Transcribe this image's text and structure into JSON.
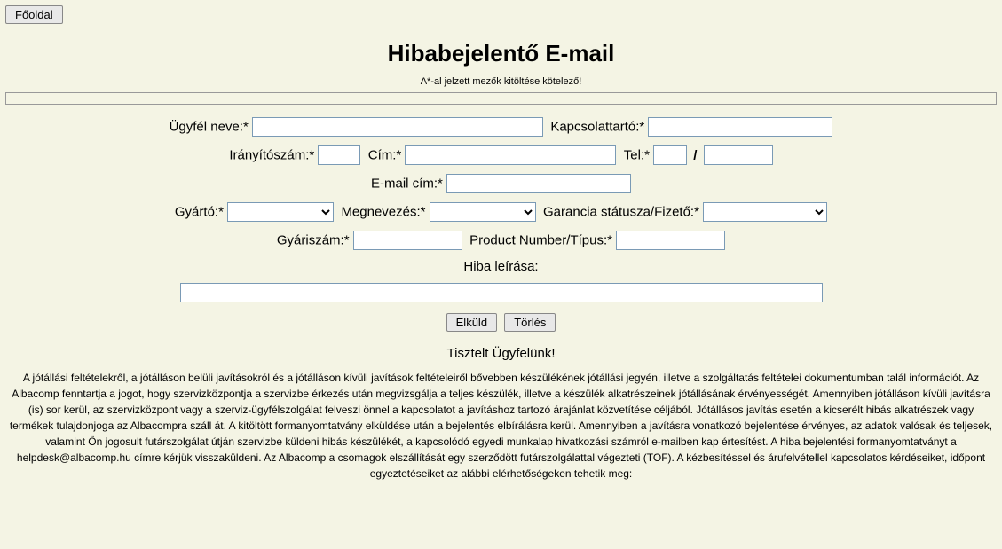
{
  "header": {
    "home_button": "Főoldal",
    "title": "Hibabejelentő E-mail",
    "subtitle": "A*-al jelzett mezők kitöltése kötelező!"
  },
  "form": {
    "customer_name_label": "Ügyfél neve:*",
    "contact_label": "Kapcsolattartó:*",
    "postal_code_label": "Irányítószám:*",
    "address_label": "Cím:*",
    "tel_label": "Tel:*",
    "email_label": "E-mail cím:*",
    "manufacturer_label": "Gyártó:*",
    "product_name_label": "Megnevezés:*",
    "warranty_status_label": "Garancia státusza/Fizető:*",
    "serial_number_label": "Gyáriszám:*",
    "product_number_label": "Product Number/Típus:*",
    "issue_desc_label": "Hiba leírása:",
    "submit_label": "Elküld",
    "reset_label": "Törlés"
  },
  "footer": {
    "greeting": "Tisztelt Ügyfelünk!",
    "body": "A jótállási feltételekről, a jótálláson belüli javításokról és a jótálláson kívüli javítások feltételeiről bővebben készülékének jótállási jegyén, illetve a szolgáltatás feltételei dokumentumban talál információt. Az Albacomp fenntartja a jogot, hogy szervizközpontja a szervizbe érkezés után megvizsgálja a teljes készülék, illetve a készülék alkatrészeinek jótállásának érvényességét. Amennyiben jótálláson kívüli javításra (is) sor kerül, az szervizközpont vagy a szerviz-ügyfélszolgálat felveszi önnel a kapcsolatot a javításhoz tartozó árajánlat közvetítése céljából. Jótállásos javítás esetén a kicserélt hibás alkatrészek vagy termékek tulajdonjoga az Albacompra száll át. A kitöltött formanyomtatvány elküldése után a bejelentés elbírálásra kerül. Amennyiben a javításra vonatkozó bejelentése érvényes, az adatok valósak és teljesek, valamint Ön jogosult futárszolgálat útján szervizbe küldeni hibás készülékét, a kapcsolódó egyedi munkalap hivatkozási számról e-mailben kap értesítést. A hiba bejelentési formanyomtatványt a helpdesk@albacomp.hu címre kérjük visszaküldeni. Az Albacomp a csomagok elszállítását egy szerződött futárszolgálattal végezteti (TOF). A kézbesítéssel és árufelvétellel kapcsolatos kérdéseiket, időpont egyeztetéseiket az alábbi elérhetőségeken tehetik meg:"
  }
}
